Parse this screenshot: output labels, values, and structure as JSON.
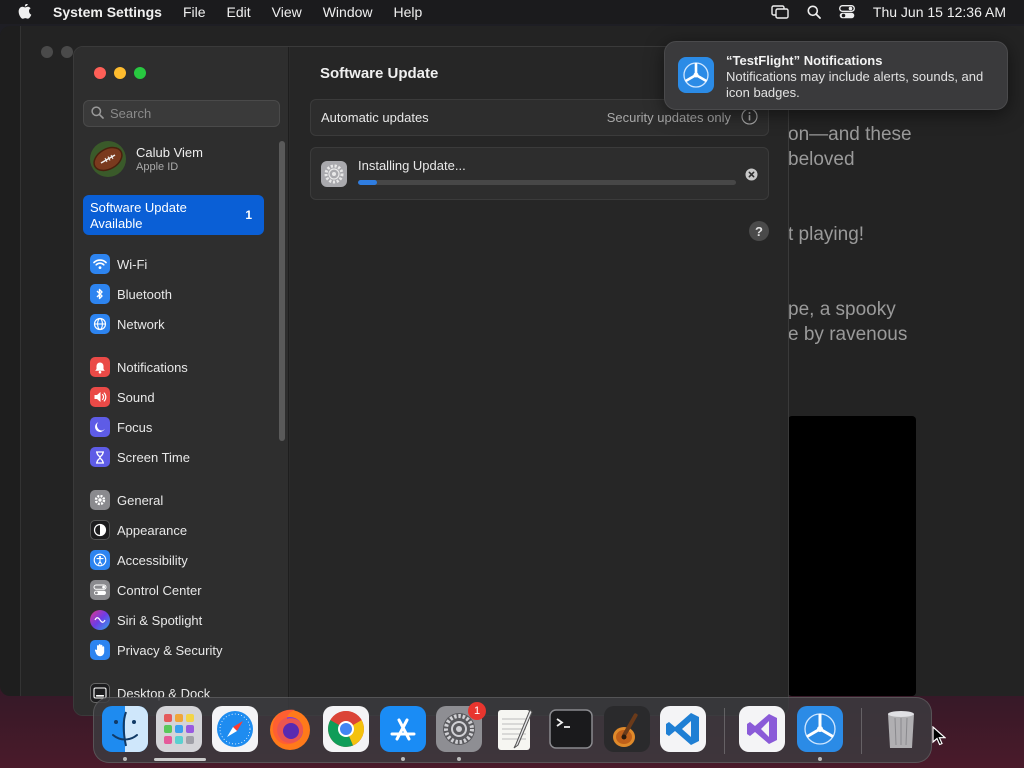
{
  "menubar": {
    "app_name": "System Settings",
    "items": [
      "File",
      "Edit",
      "View",
      "Window",
      "Help"
    ],
    "clock": "Thu Jun 15  12:36 AM"
  },
  "background_window": {
    "fragments": [
      "on—and these",
      "beloved",
      "t playing!",
      "pe, a spooky",
      "e by ravenous"
    ]
  },
  "sidebar": {
    "search_placeholder": "Search",
    "profile": {
      "name": "Calub Viem",
      "subtitle": "Apple ID"
    },
    "update_item": {
      "label": "Software Update Available",
      "count": "1"
    },
    "groups": [
      [
        {
          "label": "Wi-Fi",
          "icon": "wifi-icon",
          "color": "#2d84f0"
        },
        {
          "label": "Bluetooth",
          "icon": "bluetooth-icon",
          "color": "#2d84f0"
        },
        {
          "label": "Network",
          "icon": "globe-icon",
          "color": "#2d84f0"
        }
      ],
      [
        {
          "label": "Notifications",
          "icon": "bell-icon",
          "color": "#ea4a47"
        },
        {
          "label": "Sound",
          "icon": "speaker-icon",
          "color": "#ea4a47"
        },
        {
          "label": "Focus",
          "icon": "moon-icon",
          "color": "#5e5ce6"
        },
        {
          "label": "Screen Time",
          "icon": "hourglass-icon",
          "color": "#5e5ce6"
        }
      ],
      [
        {
          "label": "General",
          "icon": "gear-icon",
          "color": "#8a8a8e"
        },
        {
          "label": "Appearance",
          "icon": "appearance-icon",
          "color": "#1c1c1e"
        },
        {
          "label": "Accessibility",
          "icon": "accessibility-icon",
          "color": "#2d84f0"
        },
        {
          "label": "Control Center",
          "icon": "toggles-icon",
          "color": "#8a8a8e"
        },
        {
          "label": "Siri & Spotlight",
          "icon": "siri-icon",
          "color": "#b03ad4"
        },
        {
          "label": "Privacy & Security",
          "icon": "hand-icon",
          "color": "#2d84f0"
        }
      ],
      [
        {
          "label": "Desktop & Dock",
          "icon": "dock-icon",
          "color": "#1c1c1e"
        }
      ]
    ]
  },
  "content": {
    "title": "Software Update",
    "automatic": {
      "label": "Automatic updates",
      "value": "Security updates only"
    },
    "install": {
      "status": "Installing Update...",
      "progress": 0.05
    },
    "help": "?"
  },
  "notification": {
    "title": "“TestFlight” Notifications",
    "body": "Notifications may include alerts, sounds, and icon badges."
  },
  "dock": {
    "apps": [
      {
        "name": "finder",
        "running": true
      },
      {
        "name": "launchpad",
        "running": false
      },
      {
        "name": "safari",
        "running": false
      },
      {
        "name": "firefox",
        "running": false
      },
      {
        "name": "chrome",
        "running": false
      },
      {
        "name": "app-store",
        "running": true
      },
      {
        "name": "system-settings",
        "running": true,
        "badge": "1"
      },
      {
        "name": "textedit",
        "running": false
      },
      {
        "name": "terminal",
        "running": false
      },
      {
        "name": "garageband",
        "running": false
      },
      {
        "name": "vscode",
        "running": false
      },
      {
        "name": "visual-studio",
        "running": false
      },
      {
        "name": "testflight",
        "running": true
      },
      {
        "name": "trash",
        "running": false
      }
    ]
  }
}
